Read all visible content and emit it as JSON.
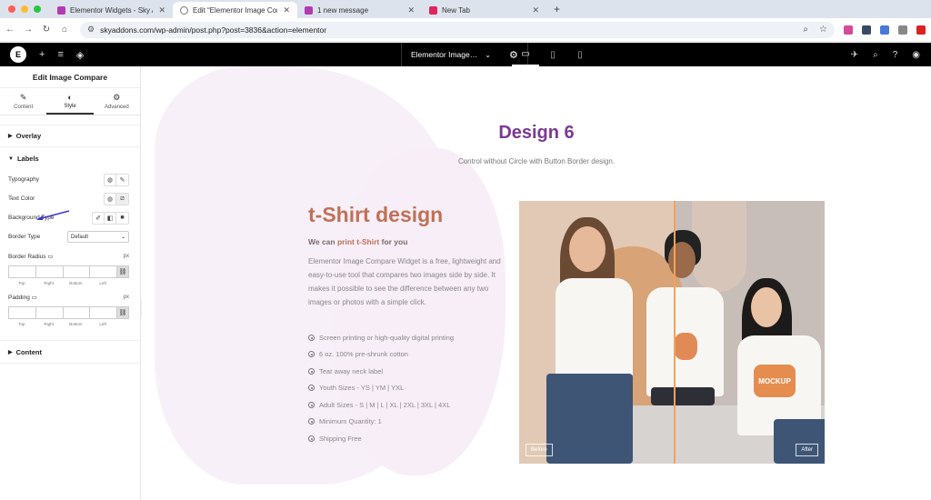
{
  "browser": {
    "tabs": [
      {
        "title": "Elementor Widgets - Sky Addo",
        "active": false,
        "color": "#b33bb5"
      },
      {
        "title": "Edit “Elementor Image Compa",
        "active": true,
        "color": "#777777"
      },
      {
        "title": "1 new message",
        "active": false,
        "color": "#b33bb5"
      },
      {
        "title": "New Tab",
        "active": false,
        "color": "#e0245e"
      }
    ],
    "url": "skyaddons.com/wp-admin/post.php?post=3836&action=elementor",
    "new_tab": "+"
  },
  "editor": {
    "document_title": "Elementor Image…",
    "panel_title": "Edit Image Compare",
    "tabs": [
      {
        "label": "Content",
        "icon": "pencil-icon"
      },
      {
        "label": "Style",
        "icon": "half-circle-icon"
      },
      {
        "label": "Advanced",
        "icon": "gear-icon"
      }
    ],
    "sections": {
      "overlay": "Overlay",
      "labels": "Labels",
      "content": "Content"
    },
    "controls": {
      "typography": "Typography",
      "text_color": "Text Color",
      "background_type": "Background Type",
      "border_type": "Border Type",
      "border_type_value": "Default",
      "border_radius": "Border Radius",
      "padding": "Padding",
      "unit": "px",
      "dims": [
        "Top",
        "Right",
        "Bottom",
        "Left"
      ]
    }
  },
  "page": {
    "heading": "Design 6",
    "subheading": "Control without Circle with Button Border design.",
    "title": "t-Shirt design",
    "we_can_prefix": "We can ",
    "we_can_accent": "print t-Shirt",
    "we_can_suffix": " for you",
    "description": "Elementor Image Compare Widget is a free, lightweight and easy-to-use tool that compares two images side by side. It makes it possible to see the difference between any two images or photos with a simple click.",
    "features": [
      "Screen printing or high-quality digital printing",
      "6 oz. 100% pre-shrunk cotton",
      "Tear away neck label",
      "Youth Sizes - YS | YM | YXL",
      "Adult Sizes - S | M | L | XL | 2XL | 3XL | 4XL",
      "Minimum Quantity: 1",
      "Shipping Free"
    ],
    "before_label": "Before",
    "after_label": "After",
    "shirt_print": "MOCKUP"
  }
}
